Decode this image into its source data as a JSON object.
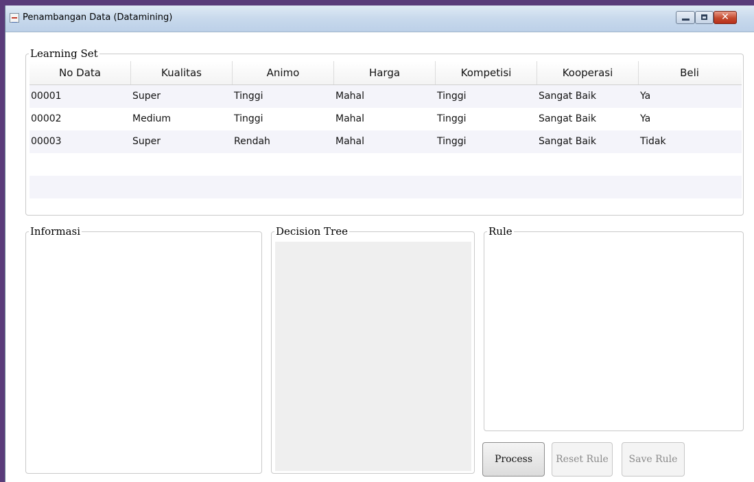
{
  "window": {
    "title": "Penambangan Data (Datamining)",
    "close_glyph": "✕"
  },
  "learning_set": {
    "legend": "Learning Set",
    "columns": [
      "No Data",
      "Kualitas",
      "Animo",
      "Harga",
      "Kompetisi",
      "Kooperasi",
      "Beli"
    ],
    "rows": [
      [
        "00001",
        "Super",
        "Tinggi",
        "Mahal",
        "Tinggi",
        "Sangat Baik",
        "Ya"
      ],
      [
        "00002",
        "Medium",
        "Tinggi",
        "Mahal",
        "Tinggi",
        "Sangat Baik",
        "Ya"
      ],
      [
        "00003",
        "Super",
        "Rendah",
        "Mahal",
        "Tinggi",
        "Sangat Baik",
        "Tidak"
      ]
    ]
  },
  "panels": {
    "informasi": "Informasi",
    "decision_tree": "Decision Tree",
    "rule": "Rule"
  },
  "buttons": {
    "process": "Process",
    "reset_rule": "Reset Rule",
    "save_rule": "Save Rule"
  },
  "icons": {
    "app": "java-app-icon",
    "minimize": "minimize-icon",
    "maximize": "maximize-icon",
    "close": "close-icon"
  }
}
